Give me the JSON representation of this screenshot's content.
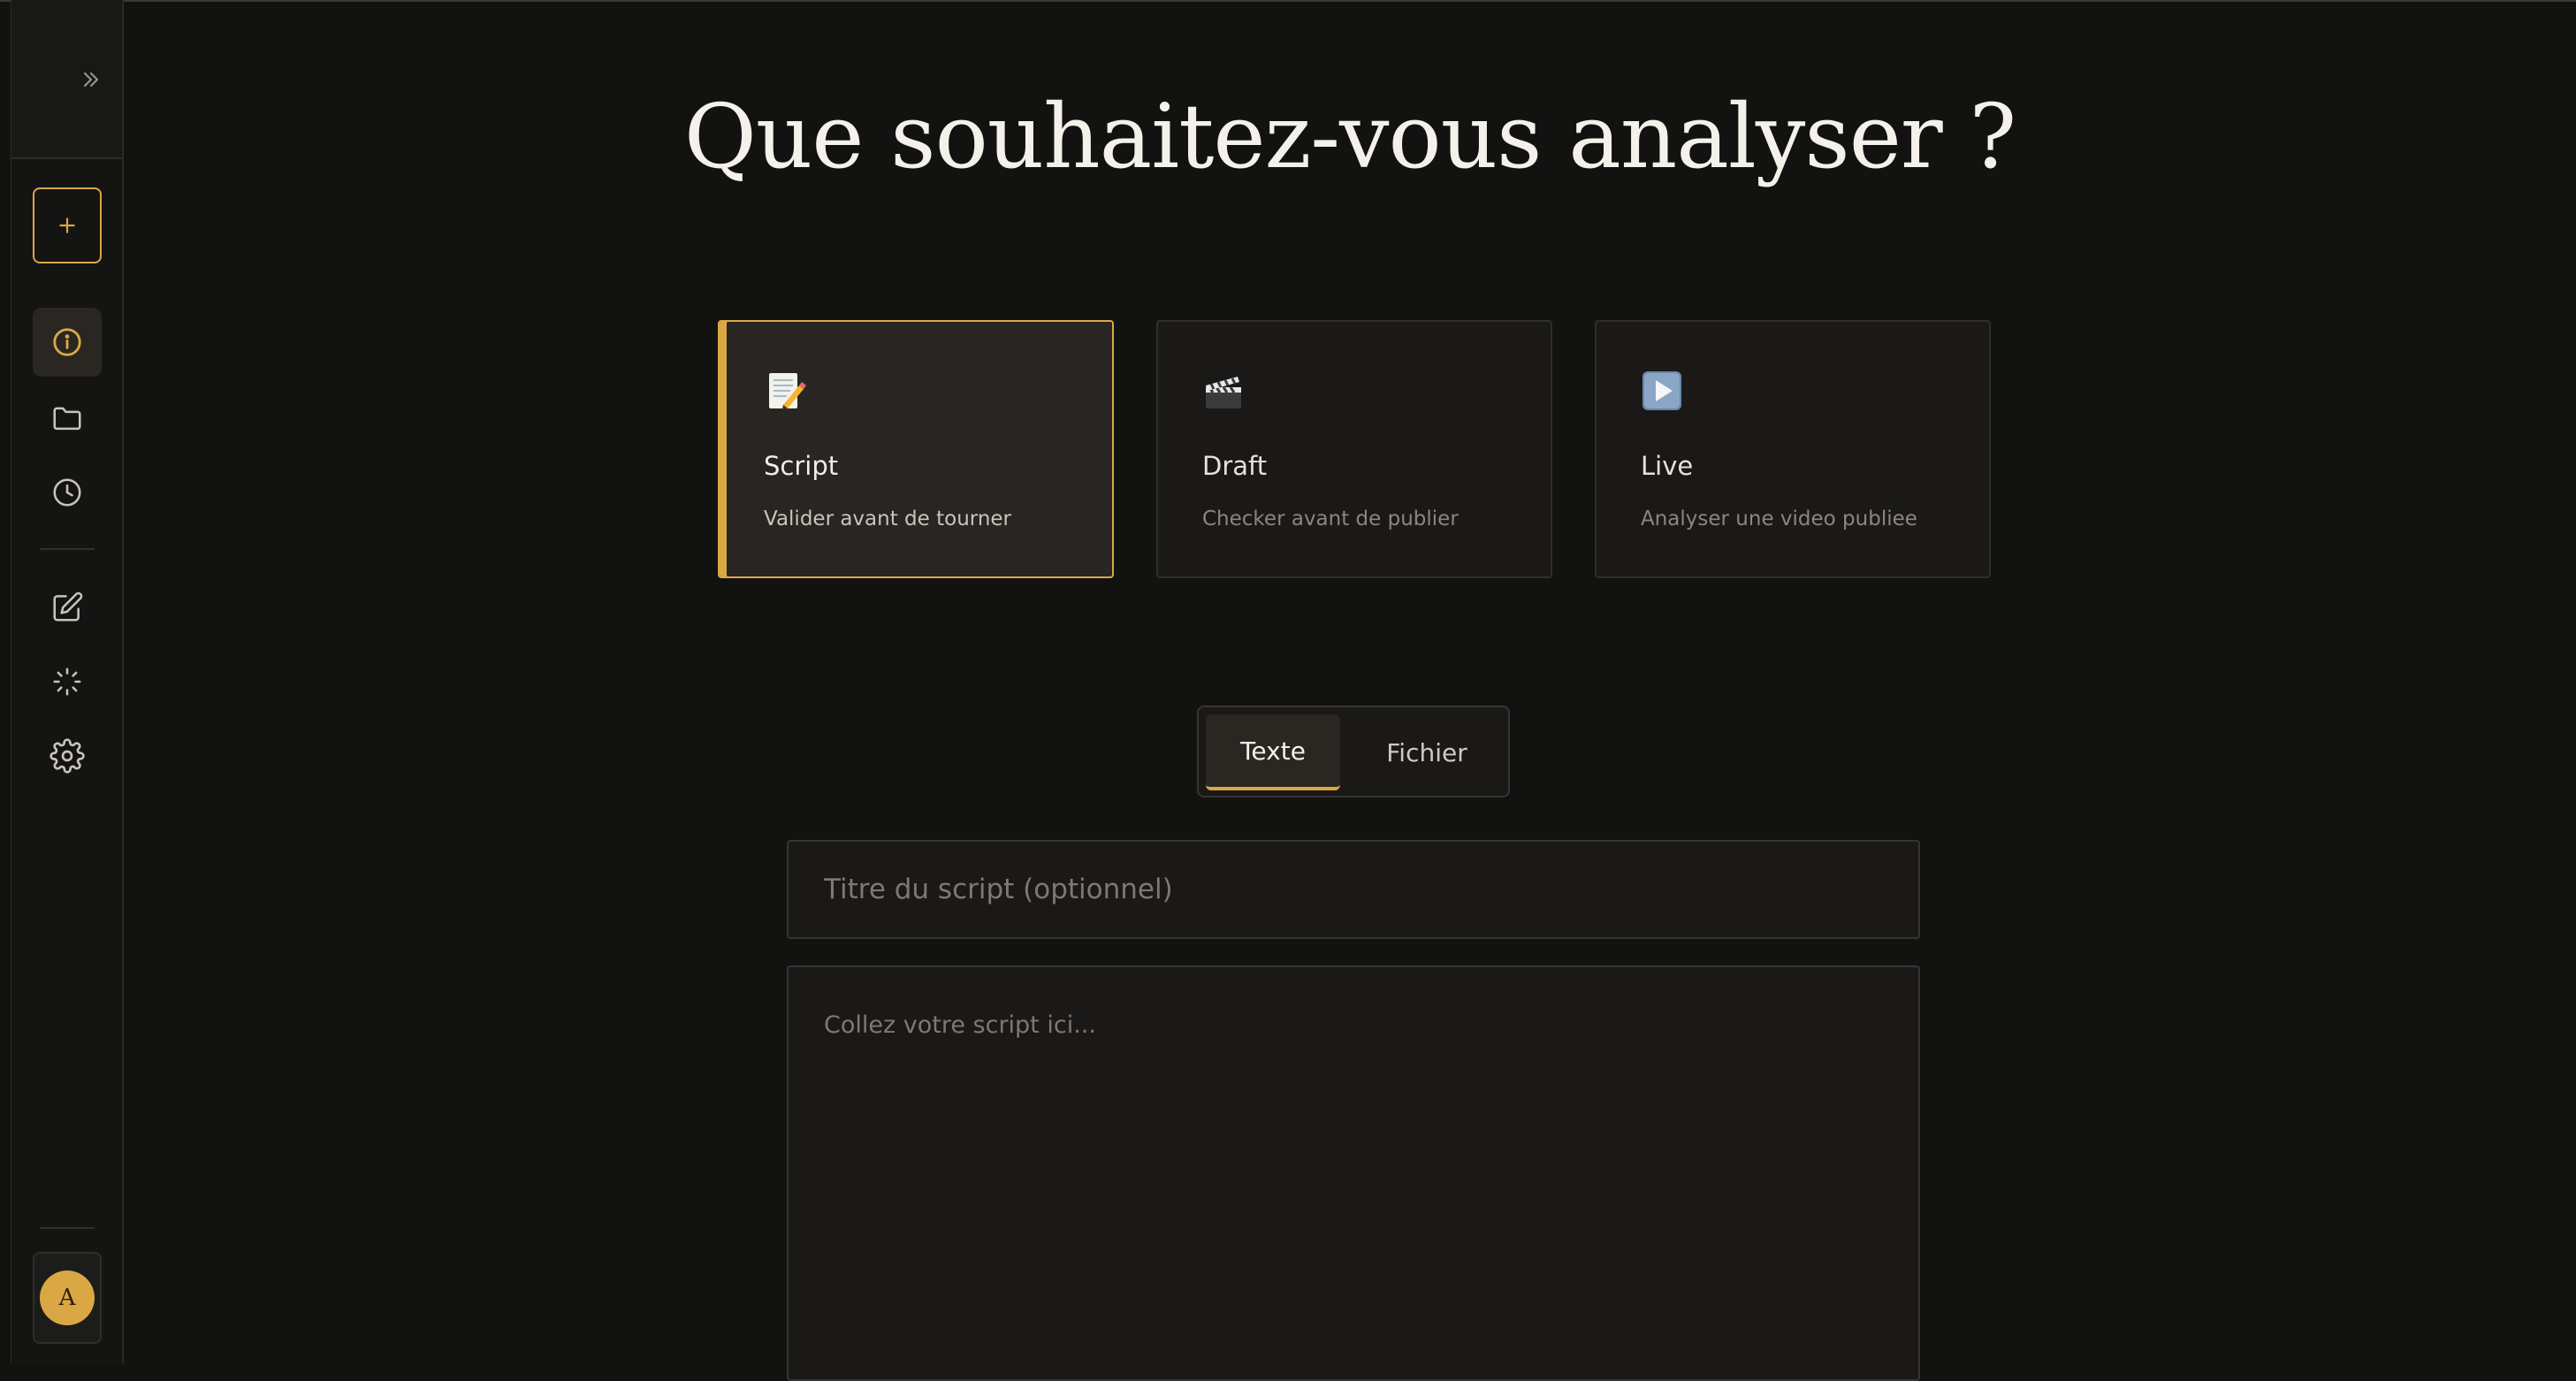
{
  "heading": "Que souhaitez-vous analyser ?",
  "cards": [
    {
      "icon": "memo-icon",
      "title": "Script",
      "subtitle": "Valider avant de tourner",
      "selected": true
    },
    {
      "icon": "clapper-board-icon",
      "title": "Draft",
      "subtitle": "Checker avant de publier",
      "selected": false
    },
    {
      "icon": "play-button-icon",
      "title": "Live",
      "subtitle": "Analyser une video publiee",
      "selected": false
    }
  ],
  "tabs": [
    {
      "label": "Texte",
      "active": true
    },
    {
      "label": "Fichier",
      "active": false
    }
  ],
  "form": {
    "title_placeholder": "Titre du script (optionnel)",
    "title_value": "",
    "script_placeholder": "Collez votre script ici...",
    "script_value": ""
  },
  "sidebar": {
    "avatar_initial": "A",
    "items": [
      "expand-icon",
      "plus-icon",
      "info-icon",
      "folder-icon",
      "clock-icon",
      "edit-icon",
      "loader-icon",
      "settings-icon"
    ]
  },
  "colors": {
    "accent": "#d9a845",
    "background": "#121211",
    "card_bg": "#1a1918"
  }
}
